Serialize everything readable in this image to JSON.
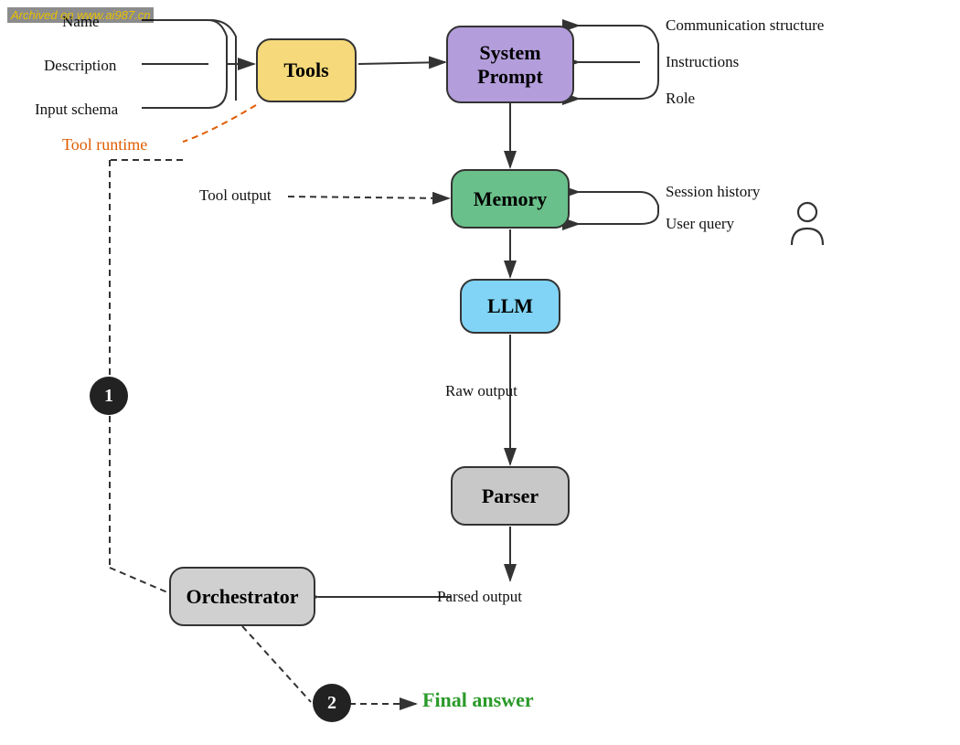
{
  "watermark": "Archived on www.ai987.cn",
  "nodes": {
    "tools": {
      "label": "Tools",
      "bg": "#f5d97a"
    },
    "system_prompt": {
      "label": "System\nPrompt",
      "bg": "#b39ddb"
    },
    "memory": {
      "label": "Memory",
      "bg": "#69c08a"
    },
    "llm": {
      "label": "LLM",
      "bg": "#81d4f5"
    },
    "parser": {
      "label": "Parser",
      "bg": "#c8c8c8"
    },
    "orchestrator": {
      "label": "Orchestrator",
      "bg": "#d0d0d0"
    }
  },
  "labels": {
    "name": "Name",
    "description": "Description",
    "input_schema": "Input schema",
    "tool_runtime": "Tool runtime",
    "tool_output": "Tool output",
    "communication_structure": "Communication structure",
    "instructions": "Instructions",
    "role": "Role",
    "session_history": "Session history",
    "user_query": "User query",
    "raw_output": "Raw output",
    "parsed_output": "Parsed output",
    "final_answer": "Final answer"
  },
  "badges": {
    "one": "1",
    "two": "2"
  }
}
